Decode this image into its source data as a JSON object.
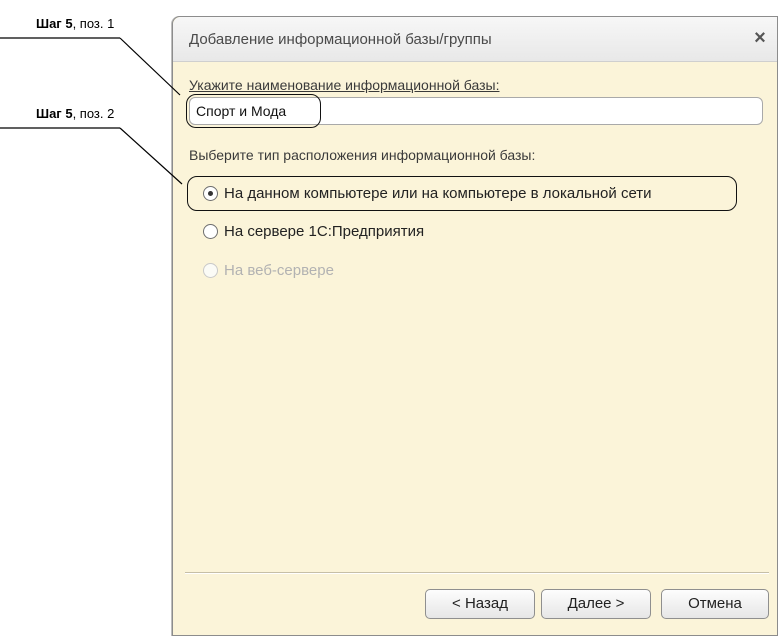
{
  "annotations": {
    "step1": {
      "bold": "Шаг 5",
      "rest": ", поз. 1"
    },
    "step2": {
      "bold": "Шаг 5",
      "rest": ", поз. 2"
    }
  },
  "dialog": {
    "title": "Добавление информационной базы/группы",
    "close_icon": "×",
    "name_label": "Укажите наименование информационной базы:",
    "name_value": "Спорт и Мода",
    "location_label": "Выберите тип расположения информационной базы:",
    "options": [
      {
        "label": "На данном компьютере или на компьютере в локальной сети",
        "checked": true,
        "disabled": false
      },
      {
        "label": "На сервере 1С:Предприятия",
        "checked": false,
        "disabled": false
      },
      {
        "label": "На веб-сервере",
        "checked": false,
        "disabled": true
      }
    ],
    "buttons": {
      "back": "< Назад",
      "next": "Далее >",
      "cancel": "Отмена"
    }
  }
}
